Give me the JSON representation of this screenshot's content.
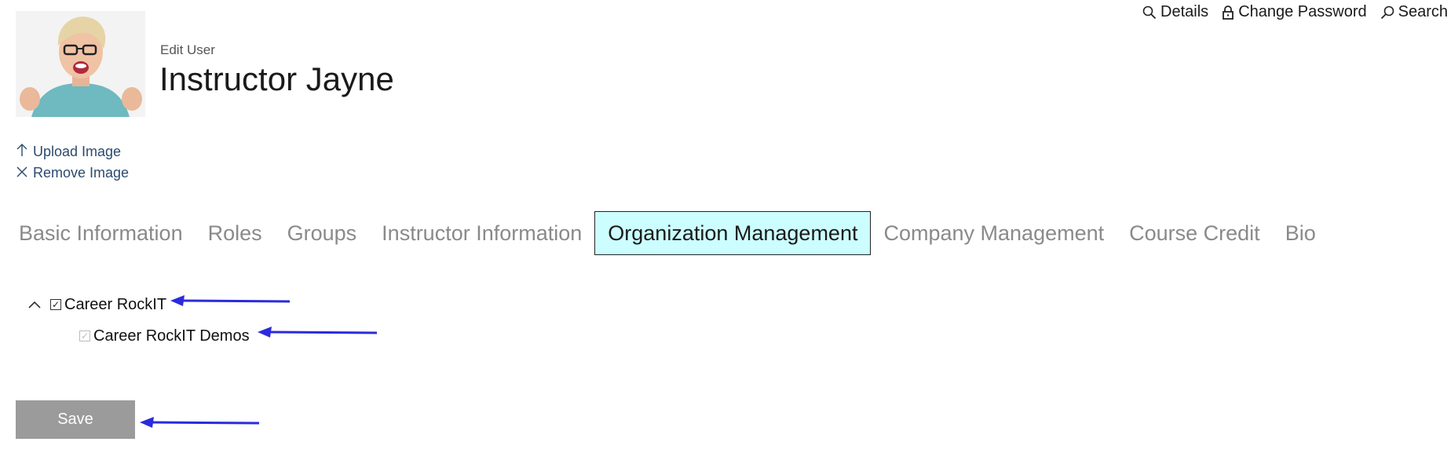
{
  "header": {
    "links": [
      {
        "label": "Details",
        "icon": "search-icon"
      },
      {
        "label": "Change Password",
        "icon": "lock-icon"
      },
      {
        "label": "Search",
        "icon": "search-icon"
      }
    ]
  },
  "profile": {
    "edit_label": "Edit User",
    "name": "Instructor Jayne",
    "upload_label": "Upload Image",
    "remove_label": "Remove Image"
  },
  "tabs": [
    {
      "label": "Basic Information",
      "active": false
    },
    {
      "label": "Roles",
      "active": false
    },
    {
      "label": "Groups",
      "active": false
    },
    {
      "label": "Instructor Information",
      "active": false
    },
    {
      "label": "Organization Management",
      "active": true
    },
    {
      "label": "Company Management",
      "active": false
    },
    {
      "label": "Course Credit",
      "active": false
    },
    {
      "label": "Bio",
      "active": false
    }
  ],
  "organizations": [
    {
      "label": "Career RockIT",
      "checked": true,
      "expanded": true,
      "disabled": false
    },
    {
      "label": "Career RockIT Demos",
      "checked": true,
      "disabled": true
    }
  ],
  "actions": {
    "save_label": "Save"
  },
  "colors": {
    "active_tab_bg": "#ccfeff",
    "link_color": "#2c4a6e",
    "save_bg": "#9b9b9b",
    "annotation_arrow": "#2b2bdc"
  }
}
